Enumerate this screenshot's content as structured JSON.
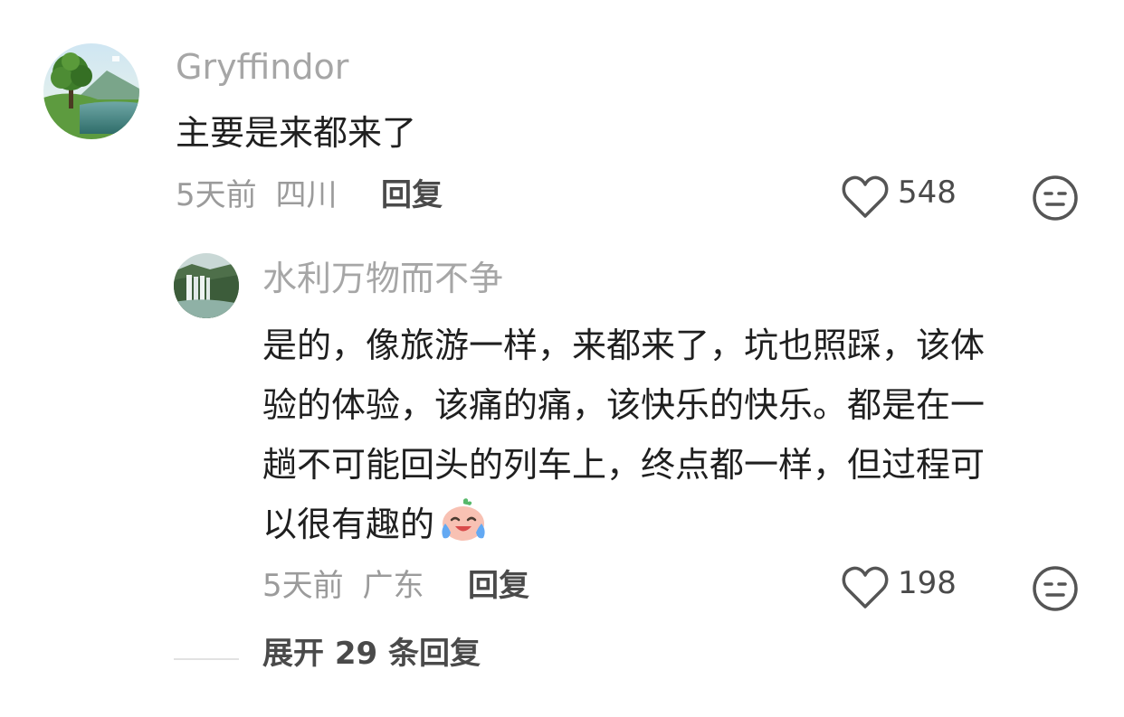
{
  "comment": {
    "username": "Gryffindor",
    "text": "主要是来都来了",
    "time": "5天前",
    "location": "四川",
    "reply_label": "回复",
    "likes": "548",
    "icons": {
      "like": "heart-outline-icon",
      "dislike": "unhappy-face-icon",
      "avatar": "landscape-tree-lake-avatar"
    }
  },
  "reply": {
    "username": "水利万物而不争",
    "lines": [
      "是的，像旅游一样，来都来了，坑也照踩，该体",
      "验的体验，该痛的痛，该快乐的快乐。都是在一",
      "趟不可能回头的列车上，终点都一样，但过程可",
      "以很有趣的"
    ],
    "time": "5天前",
    "location": "广东",
    "reply_label": "回复",
    "likes": "198",
    "icons": {
      "like": "heart-outline-icon",
      "dislike": "unhappy-face-icon",
      "emoji": "crying-laughing-emoji",
      "avatar": "waterfall-avatar"
    }
  },
  "expand_replies": "展开 29 条回复",
  "colors": {
    "username": "#a6a6a6",
    "text": "#1f1f1f",
    "meta": "#9b9b9b",
    "action": "#4a4a4a"
  }
}
